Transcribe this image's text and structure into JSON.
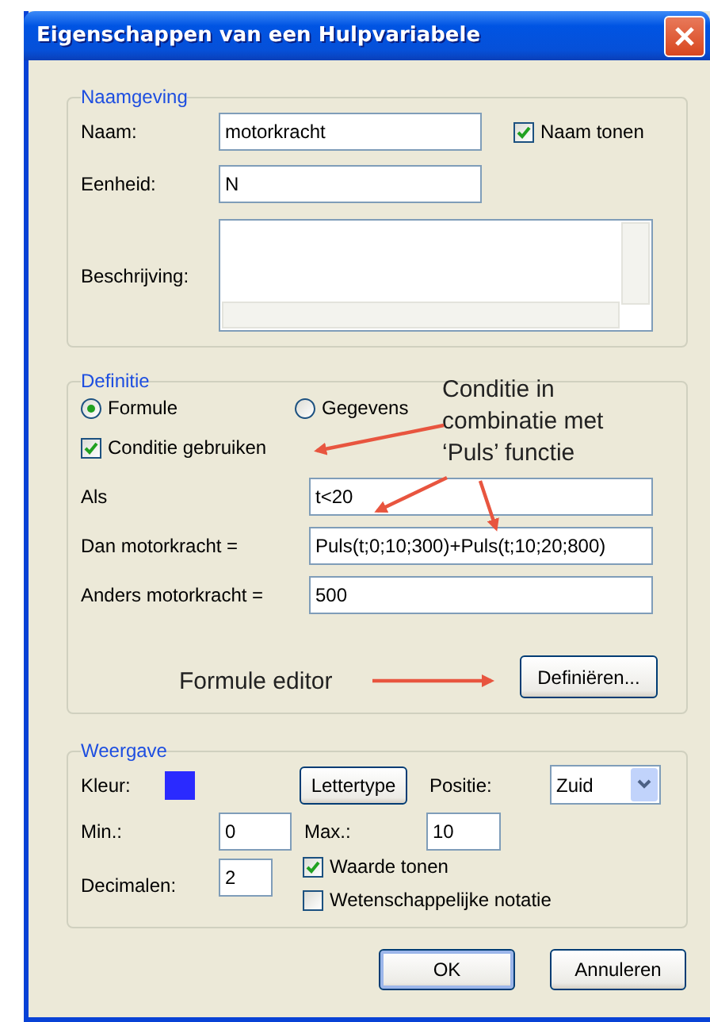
{
  "window": {
    "title": "Eigenschappen van een Hulpvariabele"
  },
  "naamgeving": {
    "legend": "Naamgeving",
    "fields": [
      {
        "label": "Naam:",
        "value": "motorkracht"
      },
      {
        "label": "Eenheid:",
        "value": "N"
      }
    ],
    "show_name": {
      "label": "Naam tonen",
      "checked": true
    },
    "description": {
      "label": "Beschrijving:"
    }
  },
  "definitie": {
    "legend": "Definitie",
    "modes": [
      {
        "label": "Formule",
        "selected": true
      },
      {
        "label": "Gegevens",
        "selected": false
      }
    ],
    "use_condition": {
      "label": "Conditie gebruiken",
      "checked": true
    },
    "fields": [
      {
        "label": "Als",
        "value": "t<20"
      },
      {
        "label": "Dan motorkracht =",
        "value": "Puls(t;0;10;300)+Puls(t;10;20;800)"
      },
      {
        "label": "Anders motorkracht =",
        "value": "500"
      }
    ],
    "define_button": "Definiëren..."
  },
  "weergave": {
    "legend": "Weergave",
    "color_label": "Kleur:",
    "color": "#2a2aff",
    "font_button": "Lettertype",
    "position": {
      "label": "Positie:",
      "value": "Zuid"
    },
    "min": {
      "label": "Min.:",
      "value": "0"
    },
    "max": {
      "label": "Max.:",
      "value": "10"
    },
    "decimals": {
      "label": "Decimalen:",
      "value": "2"
    },
    "options": [
      {
        "label": "Waarde tonen",
        "checked": true
      },
      {
        "label": "Wetenschappelijke notatie",
        "checked": false
      }
    ]
  },
  "buttons": [
    {
      "label": "OK",
      "default": true
    },
    {
      "label": "Annuleren",
      "default": false
    }
  ],
  "annotations": [
    {
      "text": "Conditie in combinatie met ‘Puls’ functie"
    },
    {
      "text": "Formule editor"
    }
  ]
}
